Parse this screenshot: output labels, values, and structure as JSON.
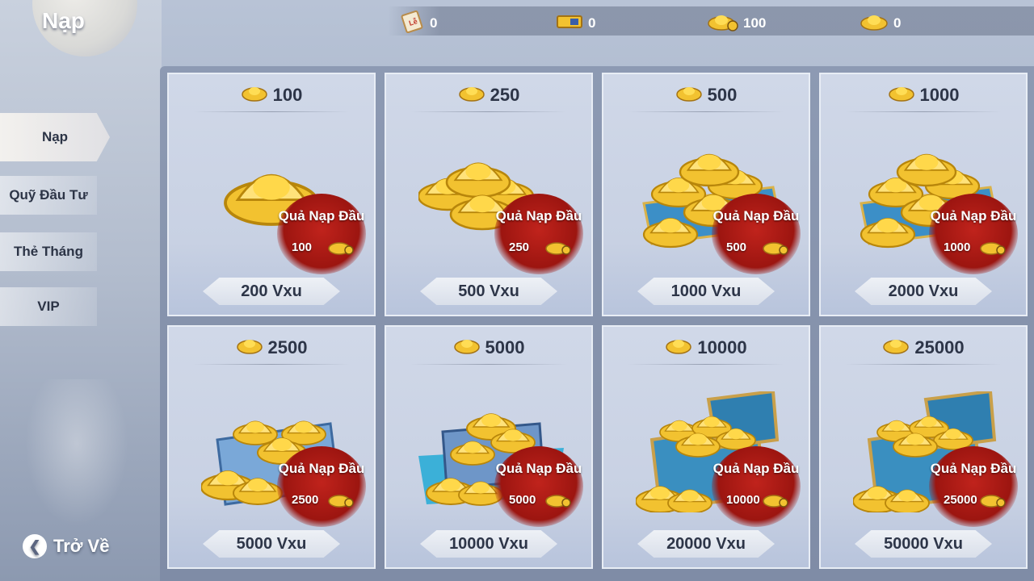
{
  "header": {
    "title": "Nạp",
    "currencies": [
      {
        "icon": "scroll-le-icon",
        "value": "0"
      },
      {
        "icon": "ticket-icon",
        "value": "0"
      },
      {
        "icon": "gold-ingot-lock-icon",
        "value": "100"
      },
      {
        "icon": "gold-ingot-icon",
        "value": "0"
      }
    ]
  },
  "sidebar": {
    "items": [
      {
        "label": "Nạp",
        "active": true
      },
      {
        "label": "Quỹ Đầu Tư",
        "active": false
      },
      {
        "label": "Thẻ Tháng",
        "active": false
      },
      {
        "label": "VIP",
        "active": false
      }
    ],
    "back_label": "Trở Về"
  },
  "packs": [
    {
      "amount": "100",
      "badge_title": "Quả Nạp Đầu",
      "badge_amount": "100",
      "price": "200 Vxu",
      "art": "single-ingot"
    },
    {
      "amount": "250",
      "badge_title": "Quả Nạp Đầu",
      "badge_amount": "250",
      "price": "500 Vxu",
      "art": "ingot-pile"
    },
    {
      "amount": "500",
      "badge_title": "Quả Nạp Đầu",
      "badge_amount": "500",
      "price": "1000 Vxu",
      "art": "ingot-mat"
    },
    {
      "amount": "1000",
      "badge_title": "Quả Nạp Đầu",
      "badge_amount": "1000",
      "price": "2000 Vxu",
      "art": "ingot-mat"
    },
    {
      "amount": "2500",
      "badge_title": "Quả Nạp Đầu",
      "badge_amount": "2500",
      "price": "5000 Vxu",
      "art": "ingot-box"
    },
    {
      "amount": "5000",
      "badge_title": "Quả Nạp Đầu",
      "badge_amount": "5000",
      "price": "10000 Vxu",
      "art": "ingot-box-cloth"
    },
    {
      "amount": "10000",
      "badge_title": "Quả Nạp Đầu",
      "badge_amount": "10000",
      "price": "20000 Vxu",
      "art": "treasure-chest"
    },
    {
      "amount": "25000",
      "badge_title": "Quả Nạp Đầu",
      "badge_amount": "25000",
      "price": "50000 Vxu",
      "art": "treasure-chest"
    }
  ],
  "colors": {
    "gold": "#f2c230",
    "badge_red": "#b01a14",
    "text_dark": "#2d3548"
  }
}
